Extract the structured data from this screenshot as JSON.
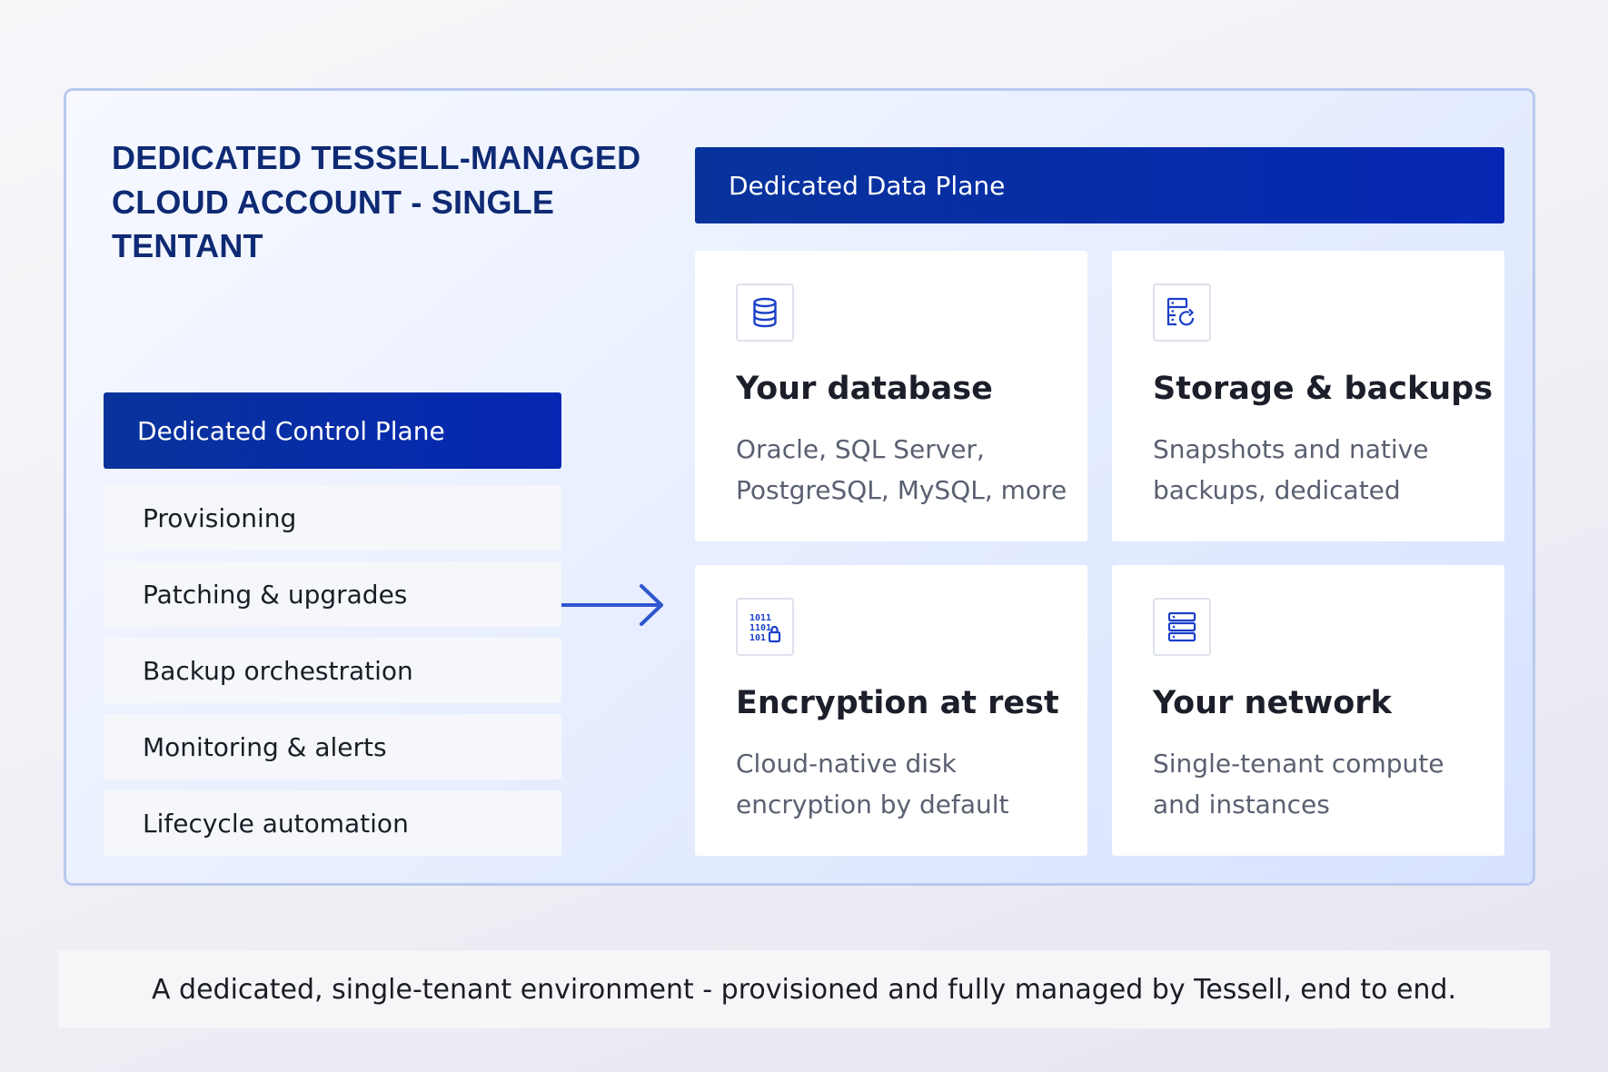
{
  "account": {
    "title": "DEDICATED TESSELL-MANAGED CLOUD ACCOUNT - SINGLE TENTANT"
  },
  "control_plane": {
    "header": "Dedicated Control Plane",
    "items": [
      "Provisioning",
      "Patching & upgrades",
      "Backup orchestration",
      "Monitoring & alerts",
      "Lifecycle automation"
    ]
  },
  "data_plane": {
    "header": "Dedicated Data Plane",
    "cards": [
      {
        "icon": "database-icon",
        "title": "Your database",
        "description": "Oracle, SQL Server, PostgreSQL, MySQL, more"
      },
      {
        "icon": "storage-backup-icon",
        "title": "Storage & backups",
        "description": "Snapshots and native backups, dedicated"
      },
      {
        "icon": "encryption-lock-icon",
        "title": "Encryption at rest",
        "description": "Cloud-native disk encryption by default"
      },
      {
        "icon": "network-server-icon",
        "title": "Your network",
        "description": "Single-tenant compute and instances"
      }
    ]
  },
  "caption": "A dedicated, single-tenant environment - provisioned and fully managed by Tessell, end to end.",
  "colors": {
    "header_blue": "#0627b3",
    "title_navy": "#0f2a74",
    "icon_blue": "#1a3fc9",
    "arrow_blue": "#2f56cf"
  }
}
